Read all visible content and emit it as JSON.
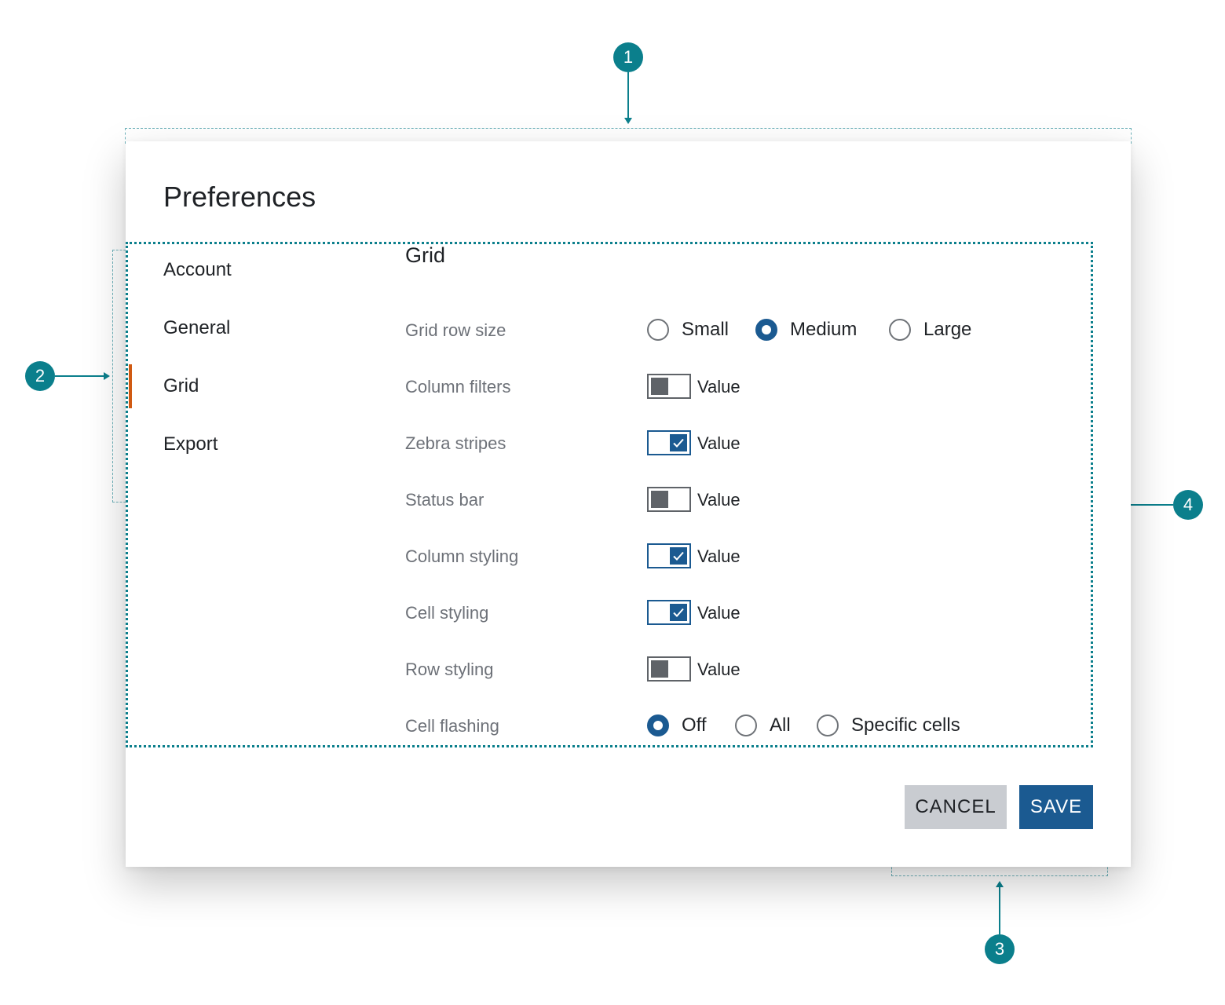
{
  "annotations": [
    "1",
    "2",
    "3",
    "4"
  ],
  "dialog": {
    "title": "Preferences",
    "nav": {
      "items": [
        "Account",
        "General",
        "Grid",
        "Export"
      ],
      "active": "Grid"
    },
    "section_title": "Grid",
    "grid_row_size": {
      "label": "Grid row size",
      "options": [
        "Small",
        "Medium",
        "Large"
      ],
      "selected": "Medium"
    },
    "toggles": [
      {
        "label": "Column filters",
        "value": "Value",
        "on": false
      },
      {
        "label": "Zebra stripes",
        "value": "Value",
        "on": true
      },
      {
        "label": "Status bar",
        "value": "Value",
        "on": false
      },
      {
        "label": "Column styling",
        "value": "Value",
        "on": true
      },
      {
        "label": "Cell styling",
        "value": "Value",
        "on": true
      },
      {
        "label": "Row styling",
        "value": "Value",
        "on": false
      }
    ],
    "cell_flashing": {
      "label": "Cell flashing",
      "options": [
        "Off",
        "All",
        "Specific cells"
      ],
      "selected": "Off"
    },
    "buttons": {
      "cancel": "CANCEL",
      "save": "SAVE"
    }
  },
  "colors": {
    "accent": "#1b5a91",
    "annotation": "#0b7f8c",
    "active_indicator": "#d05a12",
    "cancel_bg": "#c9ccd1"
  }
}
